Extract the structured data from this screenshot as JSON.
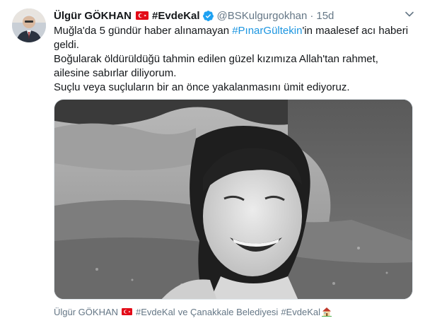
{
  "tweet": {
    "author_name": "Ülgür GÖKHAN",
    "author_flag_icon": "turkey-flag-icon",
    "author_hashtag": "#EvdeKal",
    "verified_icon": "verified-badge-icon",
    "handle": "@BSKulgurgokhan",
    "separator": "·",
    "time": "15d",
    "lines": [
      {
        "before": "Muğla'da 5 gündür haber alınamayan ",
        "link": "#PınarGültekin",
        "after": "'in maalesef acı haberi geldi."
      },
      {
        "text": "Boğularak öldürüldüğü tahmin edilen güzel kızımıza Allah'tan rahmet, ailesine sabırlar diliyorum."
      },
      {
        "text": "Suçlu veya suçluların bir an önce yakalanmasını ümit ediyoruz."
      }
    ],
    "footer": {
      "name": "Ülgür GÖKHAN",
      "hashtag1": "#EvdeKal",
      "connector": "ve Çanakkale Belediyesi",
      "hashtag2": "#EvdeKal",
      "house_icon": "house-icon"
    }
  },
  "colors": {
    "link": "#1b95e0",
    "muted": "#657786",
    "verified": "#1da1f2",
    "flag_red": "#e30a17"
  }
}
